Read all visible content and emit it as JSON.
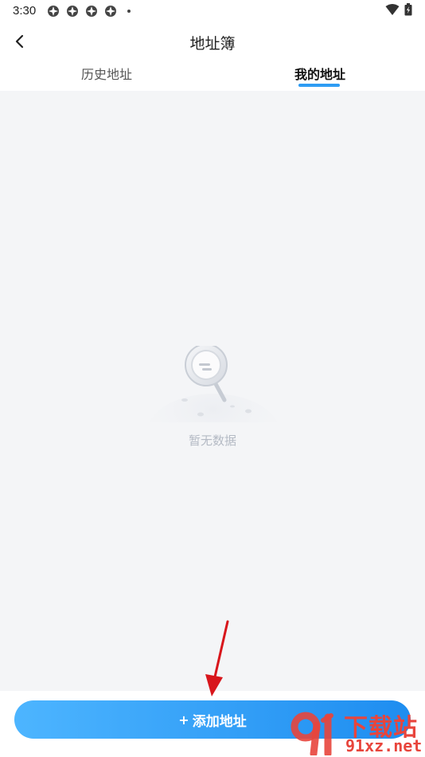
{
  "status_bar": {
    "time": "3:30",
    "notification_icons": [
      "app-notification-icon",
      "app-notification-icon",
      "app-notification-icon",
      "app-notification-icon"
    ],
    "right_icons": [
      "wifi-icon",
      "battery-icon"
    ]
  },
  "header": {
    "title": "地址簿",
    "back_icon": "chevron-left-icon"
  },
  "tabs": [
    {
      "label": "历史地址",
      "active": false
    },
    {
      "label": "我的地址",
      "active": true
    }
  ],
  "empty_state": {
    "icon": "magnifier-planet-illustration",
    "text": "暂无数据"
  },
  "bottom_button": {
    "icon": "plus-icon",
    "plus": "+",
    "label": "添加地址"
  },
  "watermark": {
    "title": "下载站",
    "domain": "91xz.net"
  },
  "colors": {
    "accent": "#2e9cf3",
    "button_gradient_start": "#4db5ff",
    "button_gradient_end": "#1e8df0",
    "content_bg": "#f4f5f7",
    "empty_text": "#b4bac4",
    "annotation_arrow": "#d8161c",
    "watermark": "#e8453c"
  }
}
